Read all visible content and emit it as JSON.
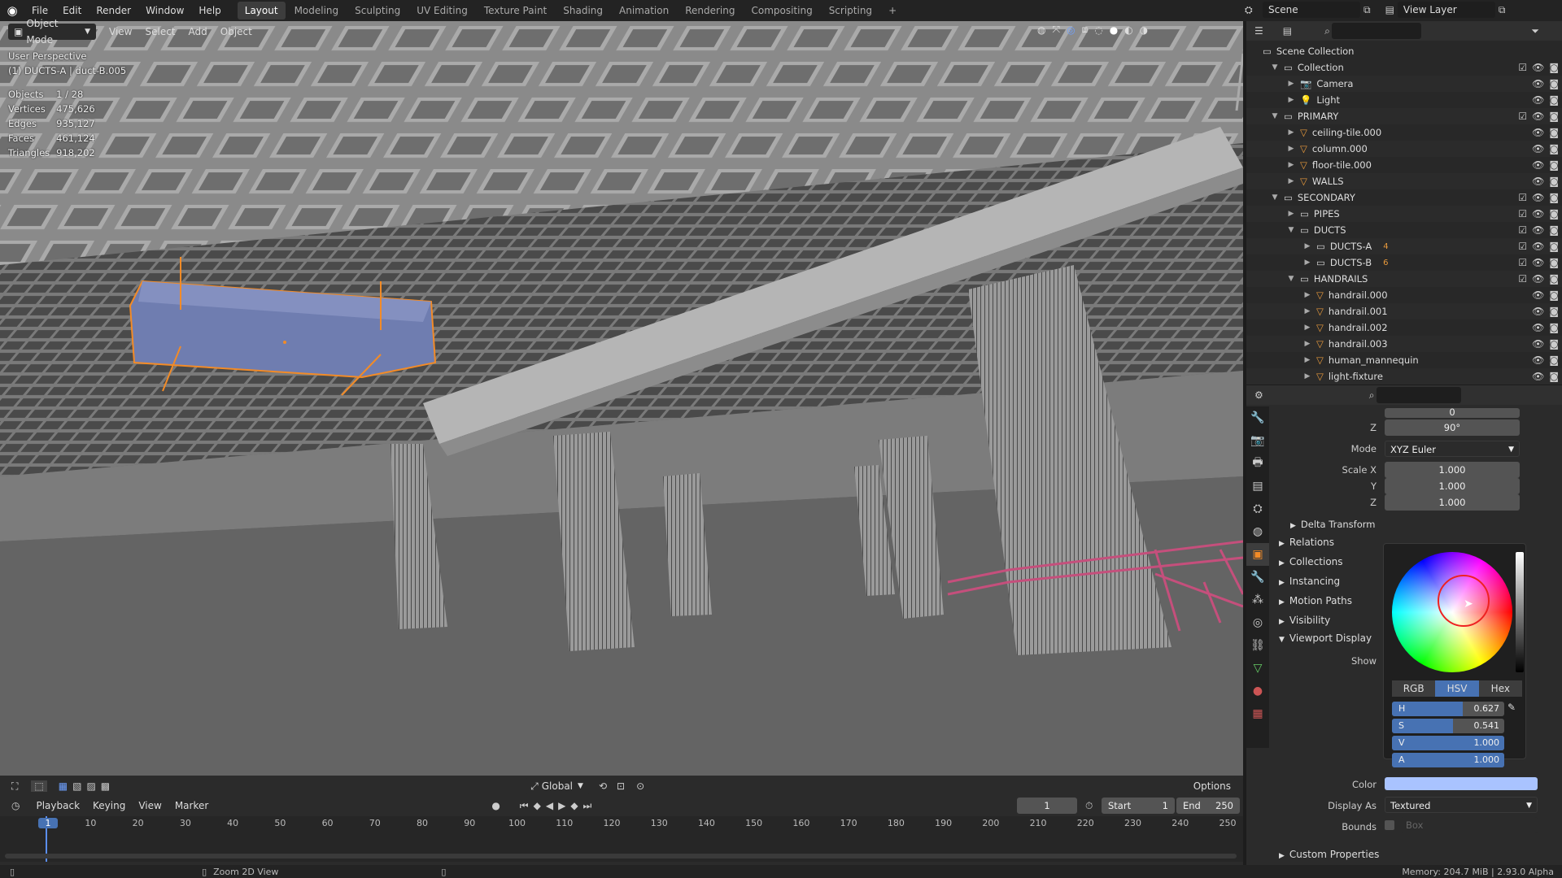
{
  "menus": [
    "File",
    "Edit",
    "Render",
    "Window",
    "Help"
  ],
  "workspaces": [
    "Layout",
    "Modeling",
    "Sculpting",
    "UV Editing",
    "Texture Paint",
    "Shading",
    "Animation",
    "Rendering",
    "Compositing",
    "Scripting",
    "+"
  ],
  "scene": {
    "name": "Scene",
    "view_layer": "View Layer"
  },
  "viewport": {
    "mode": "Object Mode",
    "menus": [
      "View",
      "Select",
      "Add",
      "Object"
    ],
    "perspective": "User Perspective",
    "active": "(1) DUCTS-A | duct-B.005",
    "stats": [
      {
        "label": "Objects",
        "value": "1 / 28"
      },
      {
        "label": "Vertices",
        "value": "475,626"
      },
      {
        "label": "Edges",
        "value": "935,127"
      },
      {
        "label": "Faces",
        "value": "461,124"
      },
      {
        "label": "Triangles",
        "value": "918,202"
      }
    ],
    "transform": "Global",
    "options": "Options"
  },
  "outliner": {
    "root": "Scene Collection",
    "rows": [
      {
        "name": "Collection",
        "depth": 1,
        "icon": "collection-icon",
        "open": true,
        "check": true
      },
      {
        "name": "Camera",
        "depth": 2,
        "icon": "camera-icon",
        "check": false
      },
      {
        "name": "Light",
        "depth": 2,
        "icon": "light-icon",
        "check": false
      },
      {
        "name": "PRIMARY",
        "depth": 1,
        "icon": "collection-icon",
        "open": true,
        "check": true
      },
      {
        "name": "ceiling-tile.000",
        "depth": 2,
        "icon": "mesh-icon",
        "check": false
      },
      {
        "name": "column.000",
        "depth": 2,
        "icon": "mesh-icon",
        "check": false
      },
      {
        "name": "floor-tile.000",
        "depth": 2,
        "icon": "mesh-icon",
        "check": false
      },
      {
        "name": "WALLS",
        "depth": 2,
        "icon": "mesh-icon",
        "check": false
      },
      {
        "name": "SECONDARY",
        "depth": 1,
        "icon": "collection-icon",
        "open": true,
        "check": true
      },
      {
        "name": "PIPES",
        "depth": 2,
        "icon": "collection-icon",
        "check": true
      },
      {
        "name": "DUCTS",
        "depth": 2,
        "icon": "collection-icon",
        "open": true,
        "check": true
      },
      {
        "name": "DUCTS-A",
        "depth": 3,
        "icon": "collection-icon",
        "check": true,
        "badge": "4"
      },
      {
        "name": "DUCTS-B",
        "depth": 3,
        "icon": "collection-icon",
        "check": true,
        "badge": "6"
      },
      {
        "name": "HANDRAILS",
        "depth": 2,
        "icon": "collection-icon",
        "open": true,
        "check": true
      },
      {
        "name": "handrail.000",
        "depth": 3,
        "icon": "mesh-icon",
        "check": false
      },
      {
        "name": "handrail.001",
        "depth": 3,
        "icon": "mesh-icon",
        "check": false
      },
      {
        "name": "handrail.002",
        "depth": 3,
        "icon": "mesh-icon",
        "check": false
      },
      {
        "name": "handrail.003",
        "depth": 3,
        "icon": "mesh-icon",
        "check": false
      },
      {
        "name": "human_mannequin",
        "depth": 3,
        "icon": "mesh-icon",
        "check": false
      },
      {
        "name": "light-fixture",
        "depth": 3,
        "icon": "mesh-icon",
        "check": false
      }
    ]
  },
  "properties": {
    "rot_y": "0",
    "rot_z_label": "Z",
    "rot_z": "90°",
    "mode_label": "Mode",
    "mode": "XYZ Euler",
    "scale_x_label": "Scale X",
    "scale_x": "1.000",
    "scale_y_label": "Y",
    "scale_y": "1.000",
    "scale_z_label": "Z",
    "scale_z": "1.000",
    "delta": "Delta Transform",
    "panels": [
      "Relations",
      "Collections",
      "Instancing",
      "Motion Paths",
      "Visibility"
    ],
    "viewport_display": "Viewport Display",
    "show_label": "Show",
    "color_tabs": [
      "RGB",
      "HSV",
      "Hex"
    ],
    "hsv": [
      {
        "k": "H",
        "v": "0.627"
      },
      {
        "k": "S",
        "v": "0.541"
      },
      {
        "k": "V",
        "v": "1.000"
      },
      {
        "k": "A",
        "v": "1.000"
      }
    ],
    "hsv_values": [
      0.627,
      0.541,
      1.0,
      1.0
    ],
    "color_label": "Color",
    "color_hex": "#a9c3ff",
    "display_as_label": "Display As",
    "display_as": "Textured",
    "bounds_label": "Bounds",
    "bounds": "Box",
    "custom": "Custom Properties"
  },
  "timeline": {
    "menus": [
      "Playback",
      "Keying",
      "View",
      "Marker"
    ],
    "frame": "1",
    "start_label": "Start",
    "start": "1",
    "end_label": "End",
    "end": "250",
    "ticks": [
      "1",
      "10",
      "20",
      "30",
      "40",
      "50",
      "60",
      "70",
      "80",
      "90",
      "100",
      "110",
      "120",
      "130",
      "140",
      "150",
      "160",
      "170",
      "180",
      "190",
      "200",
      "210",
      "220",
      "230",
      "240",
      "250"
    ]
  },
  "status": {
    "hint": "Zoom 2D View",
    "memory": "Memory: 204.7 MiB | 2.93.0 Alpha"
  },
  "colors": {
    "selection": "#f28b27",
    "duct": "#6f7db0",
    "handrail": "#c54f7c"
  }
}
